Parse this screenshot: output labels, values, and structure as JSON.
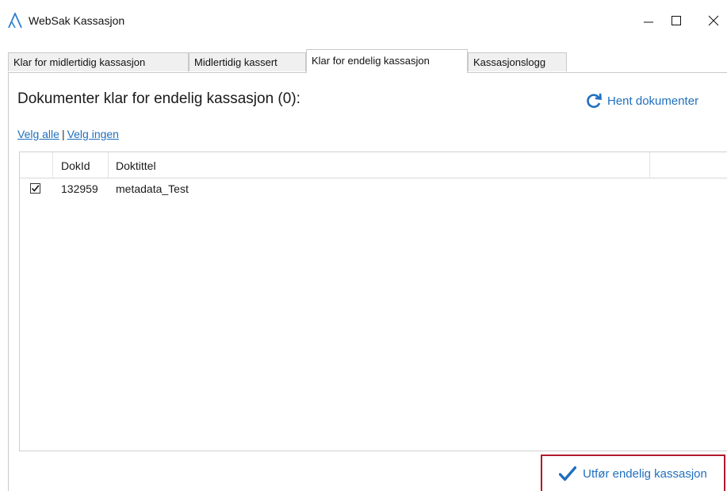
{
  "window": {
    "title": "WebSak Kassasjon"
  },
  "tabs": [
    {
      "label": "Klar for midlertidig kassasjon",
      "active": false
    },
    {
      "label": "Midlertidig kassert",
      "active": false
    },
    {
      "label": "Klar for endelig kassasjon",
      "active": true
    },
    {
      "label": "Kassasjonslogg",
      "active": false
    }
  ],
  "main": {
    "heading": "Dokumenter klar for endelig kassasjon (0):",
    "fetch_label": "Hent dokumenter",
    "select_all": "Velg alle",
    "separator": "|",
    "select_none": "Velg ingen"
  },
  "grid": {
    "columns": [
      "DokId",
      "Doktittel"
    ],
    "rows": [
      {
        "checked": true,
        "dokid": "132959",
        "title": "metadata_Test"
      }
    ]
  },
  "footer": {
    "execute_label": "Utfør endelig kassasjon"
  },
  "colors": {
    "accent": "#1f6fbf",
    "highlight_border": "#b2182b"
  }
}
